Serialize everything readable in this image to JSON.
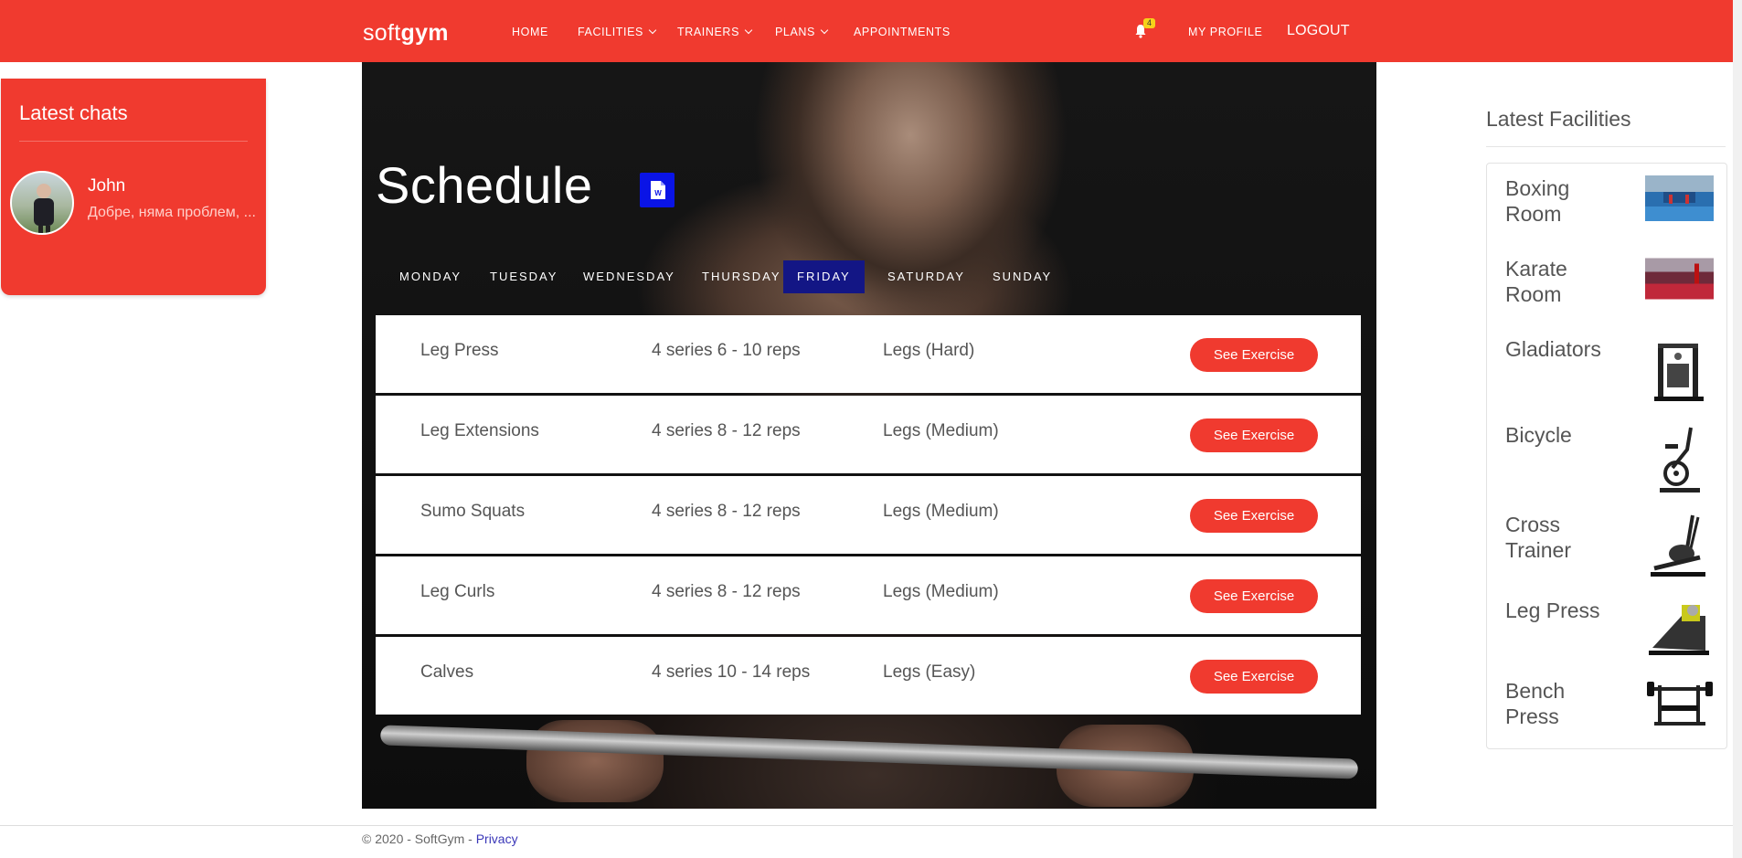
{
  "nav": {
    "brand_light": "soft",
    "brand_bold": "gym",
    "items": [
      {
        "label": "HOME",
        "dropdown": false
      },
      {
        "label": "FACILITIES",
        "dropdown": true
      },
      {
        "label": "TRAINERS",
        "dropdown": true
      },
      {
        "label": "PLANS",
        "dropdown": true
      },
      {
        "label": "APPOINTMENTS",
        "dropdown": false
      }
    ],
    "notification_count": "4",
    "my_profile": "MY PROFILE",
    "logout": "LOGOUT"
  },
  "chats": {
    "title": "Latest chats",
    "items": [
      {
        "name": "John",
        "message": "Добре, няма проблем, ..."
      }
    ]
  },
  "schedule": {
    "title": "Schedule",
    "days": [
      "MONDAY",
      "TUESDAY",
      "WEDNESDAY",
      "THURSDAY",
      "FRIDAY",
      "SATURDAY",
      "SUNDAY"
    ],
    "active_day": "FRIDAY",
    "exercises": [
      {
        "name": "Leg Press",
        "sets": "4 series 6 - 10 reps",
        "level": "Legs (Hard)",
        "button": "See Exercise"
      },
      {
        "name": "Leg Extensions",
        "sets": "4 series 8 - 12 reps",
        "level": "Legs (Medium)",
        "button": "See Exercise"
      },
      {
        "name": "Sumo Squats",
        "sets": "4 series 8 - 12 reps",
        "level": "Legs (Medium)",
        "button": "See Exercise"
      },
      {
        "name": "Leg Curls",
        "sets": "4 series 8 - 12 reps",
        "level": "Legs (Medium)",
        "button": "See Exercise"
      },
      {
        "name": "Calves",
        "sets": "4 series 10 - 14 reps",
        "level": "Legs (Easy)",
        "button": "See Exercise"
      }
    ]
  },
  "facilities": {
    "title": "Latest Facilities",
    "items": [
      {
        "name": "Boxing Room",
        "icon": "boxing-room-photo"
      },
      {
        "name": "Karate Room",
        "icon": "karate-room-photo"
      },
      {
        "name": "Gladiators",
        "icon": "gladiators-machine-image"
      },
      {
        "name": "Bicycle",
        "icon": "bicycle-machine-image"
      },
      {
        "name": "Cross Trainer",
        "icon": "cross-trainer-image"
      },
      {
        "name": "Leg Press",
        "icon": "leg-press-machine-image"
      },
      {
        "name": "Bench Press",
        "icon": "bench-press-image"
      }
    ]
  },
  "footer": {
    "copyright": "© 2020 - SoftGym - ",
    "privacy": "Privacy"
  },
  "colors": {
    "brand_red": "#f03a2f",
    "active_tab": "#131685",
    "word_icon": "#0a14e6",
    "badge": "#f6d21a"
  }
}
